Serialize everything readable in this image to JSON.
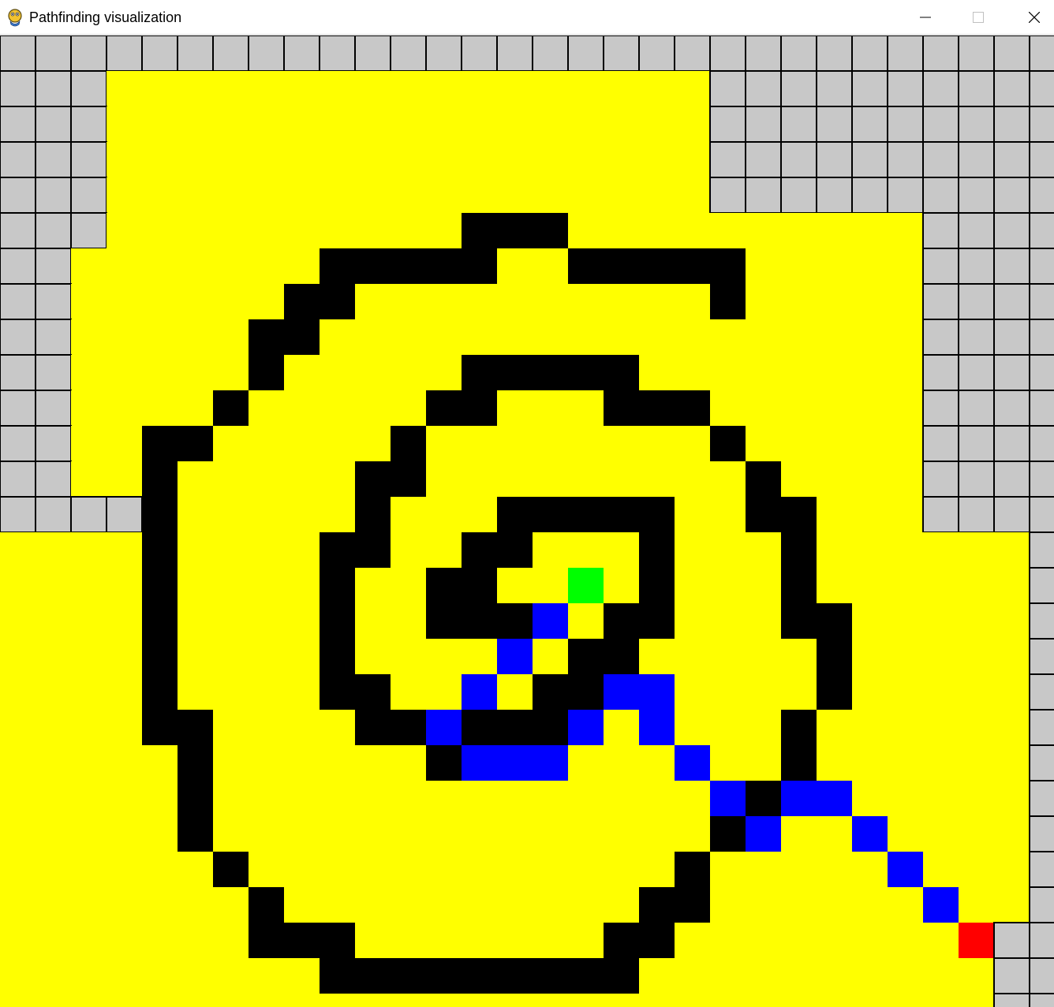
{
  "window": {
    "title": "Pathfinding visualization",
    "icon": "pygame-snake-icon",
    "controls": [
      "minimize-icon",
      "maximize-icon",
      "close-icon"
    ]
  },
  "grid": {
    "cols": 30,
    "rows": 28,
    "colors": {
      "unvisited": "#c8c8c8",
      "visited": "#ffff00",
      "wall": "#000000",
      "path": "#0000ff",
      "start": "#00ff00",
      "end": "#ff0000",
      "gridline": "#000000"
    },
    "cells": [
      "##############################",
      "###YYYYYYYYYYYYYYYYY##########",
      "###YYYYYYYYYYYYYYYYY##########",
      "###YYYYYYYYYYYYYYYYY##########",
      "###YYYYYYYYYYYYYYYYY##########",
      "###YYYYYYYYYYWWWYYYYYYYYYY####",
      "##YYYYYYYWWWWWYYWWWWWYYYYY####",
      "##YYYYYYWWYYYYYYYYYYWYYYYY####",
      "##YYYYYWWYYYYYYYYYYYYYYYYY####",
      "##YYYYYWYYYYYWWWWWYYYYYYYY####",
      "##YYYYWYYYYYWWYYYWWWYYYYYY####",
      "##YYWWYYYYYWYYYYYYYYWYYYYY####",
      "##YYWYYYYYWWYYYYYYYYYWYYYY####",
      "####WYYYYYWYYYWWWWWYYWWYYY####",
      "YYYYWYYYYWWYYWWYYYWYYYWYYYYYY#",
      "YYYYWYYYYWYYWWYYSYWYYYWYYYYYY#",
      "YYYYWYYYYWYYWWWPYWWYYYWWYYYYY#",
      "YYYYWYYYYWYYYYPYWWYYYYYWYYYYY#",
      "YYYYWYYYYWWYYPYWWPPYYYYWYYYYY#",
      "YYYYWWYYYYWWPWWWPYPYYYWYYYYYY#",
      "YYYYYWYYYYYYWPPPYYYPYYWYYYYYY#",
      "YYYYYWYYYYYYYYYYYYYYPWPPYYYYY#",
      "YYYYYWYYYYYYYYYYYYYYWPYYPYYYY#",
      "YYYYYYWYYYYYYYYYYYYWYYYYYPYYY#",
      "YYYYYYYWYYYYYYYYYYWWYYYYYYPYY#",
      "YYYYYYYWWWYYYYYYYWWYYYYYYYYE##",
      "YYYYYYYYYWWWWWWWWWYYYYYYYYYY##",
      "YYYYYYYYYYYYYYYYYYYYYYYYYYYY##"
    ]
  }
}
